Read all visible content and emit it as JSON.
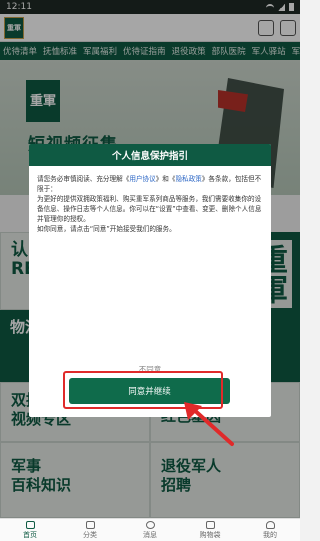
{
  "status_bar": {
    "time": "12:11"
  },
  "header": {
    "logo_text": "重軍"
  },
  "tabs": [
    "优待清单",
    "抚恤标准",
    "军属福利",
    "优待证指南",
    "退役政策",
    "部队医院",
    "军人驿站",
    "军事"
  ],
  "banner": {
    "logo_text": "重軍",
    "title": "短视频征集"
  },
  "grid": {
    "cells": [
      {
        "label": "认\nRE"
      },
      {
        "label": "物流"
      },
      {
        "label": "双拥\n视频专区"
      },
      {
        "label": "红色基因"
      },
      {
        "label": "军事\n百科知识"
      },
      {
        "label": "退役军人\n招聘"
      }
    ],
    "side_mark": "重軍"
  },
  "dialog": {
    "title": "个人信息保护指引",
    "body_intro": "请您务必审慎阅读、充分理解《",
    "user_agreement": "用户协议",
    "and": "》和《",
    "privacy_policy": "隐私政策",
    "body_rest": "》各条款，包括但不限于：",
    "body_para2": "为更好的提供双拥政策福利、购买重军系列商品等服务，我们需要收集你的设备信息、操作日志等个人信息。你可以在“设置”中查看、变更、删除个人信息并管理你的授权。",
    "body_para3": "如你同意，请点击“同意”开始接受我们的服务。",
    "disagree_label": "不同意",
    "agree_label": "同意并继续"
  },
  "bottom_nav": [
    {
      "label": "首页",
      "icon": "home-icon"
    },
    {
      "label": "分类",
      "icon": "grid-icon"
    },
    {
      "label": "消息",
      "icon": "message-icon"
    },
    {
      "label": "购物袋",
      "icon": "bag-icon"
    },
    {
      "label": "我的",
      "icon": "user-icon"
    }
  ],
  "colors": {
    "brand_green": "#0f5a43",
    "highlight_red": "#e02a2a",
    "link_blue": "#2b66c5"
  }
}
